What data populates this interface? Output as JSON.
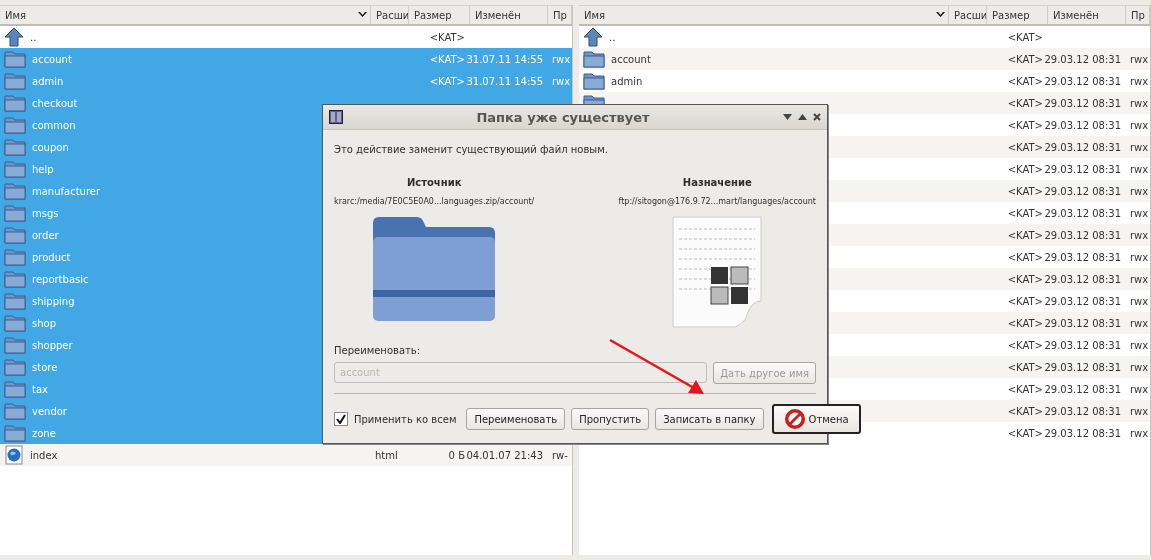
{
  "panels": [
    {
      "columns": [
        "Имя",
        "Расши",
        "Размер",
        "Изменён",
        "Пр"
      ],
      "rows": [
        {
          "kind": "parent",
          "name": "..",
          "size": "<KAT>",
          "selected": false
        },
        {
          "kind": "folder",
          "name": "account",
          "size": "<KAT>",
          "modified": "31.07.11 14:55",
          "perms": "rwx",
          "selected": true
        },
        {
          "kind": "folder",
          "name": "admin",
          "size": "<KAT>",
          "modified": "31.07.11 14:55",
          "perms": "rwx",
          "selected": true
        },
        {
          "kind": "folder",
          "name": "checkout",
          "selected": true
        },
        {
          "kind": "folder",
          "name": "common",
          "selected": true
        },
        {
          "kind": "folder",
          "name": "coupon",
          "selected": true
        },
        {
          "kind": "folder",
          "name": "help",
          "selected": true
        },
        {
          "kind": "folder",
          "name": "manufacturer",
          "selected": true
        },
        {
          "kind": "folder",
          "name": "msgs",
          "selected": true
        },
        {
          "kind": "folder",
          "name": "order",
          "selected": true
        },
        {
          "kind": "folder",
          "name": "product",
          "selected": true
        },
        {
          "kind": "folder",
          "name": "reportbasic",
          "selected": true
        },
        {
          "kind": "folder",
          "name": "shipping",
          "selected": true
        },
        {
          "kind": "folder",
          "name": "shop",
          "selected": true
        },
        {
          "kind": "folder",
          "name": "shopper",
          "selected": true
        },
        {
          "kind": "folder",
          "name": "store",
          "selected": true
        },
        {
          "kind": "folder",
          "name": "tax",
          "selected": true
        },
        {
          "kind": "folder",
          "name": "vendor",
          "selected": true
        },
        {
          "kind": "folder",
          "name": "zone",
          "selected": true
        },
        {
          "kind": "file",
          "name": "index",
          "ext": "html",
          "size": "0 Б",
          "modified": "04.01.07 21:43",
          "perms": "rw-",
          "selected": false
        }
      ]
    },
    {
      "columns": [
        "Имя",
        "Расши",
        "Размер",
        "Изменён",
        "Пр"
      ],
      "rows": [
        {
          "kind": "parent",
          "name": "..",
          "size": "<KAT>",
          "selected": false
        },
        {
          "kind": "folder",
          "name": "account",
          "size": "<KAT>",
          "modified": "29.03.12 08:31",
          "perms": "rwx",
          "selected": false
        },
        {
          "kind": "folder",
          "name": "admin",
          "size": "<KAT>",
          "modified": "29.03.12 08:31",
          "perms": "rwx",
          "selected": false
        },
        {
          "kind": "folder",
          "size": "<KAT>",
          "modified": "29.03.12 08:31",
          "perms": "rwx",
          "selected": false
        },
        {
          "size": "<KAT>",
          "modified": "29.03.12 08:31",
          "perms": "rwx",
          "selected": false
        },
        {
          "size": "<KAT>",
          "modified": "29.03.12 08:31",
          "perms": "rwx",
          "selected": false
        },
        {
          "size": "<KAT>",
          "modified": "29.03.12 08:31",
          "perms": "rwx",
          "selected": false
        },
        {
          "size": "<KAT>",
          "modified": "29.03.12 08:31",
          "perms": "rwx",
          "selected": false
        },
        {
          "size": "<KAT>",
          "modified": "29.03.12 08:31",
          "perms": "rwx",
          "selected": false
        },
        {
          "size": "<KAT>",
          "modified": "29.03.12 08:31",
          "perms": "rwx",
          "selected": false
        },
        {
          "size": "<KAT>",
          "modified": "29.03.12 08:31",
          "perms": "rwx",
          "selected": false
        },
        {
          "size": "<KAT>",
          "modified": "29.03.12 08:31",
          "perms": "rwx",
          "selected": false
        },
        {
          "size": "<KAT>",
          "modified": "29.03.12 08:31",
          "perms": "rwx",
          "selected": false
        },
        {
          "size": "<KAT>",
          "modified": "29.03.12 08:31",
          "perms": "rwx",
          "selected": false
        },
        {
          "size": "<KAT>",
          "modified": "29.03.12 08:31",
          "perms": "rwx",
          "selected": false
        },
        {
          "size": "<KAT>",
          "modified": "29.03.12 08:31",
          "perms": "rwx",
          "selected": false
        },
        {
          "size": "<KAT>",
          "modified": "29.03.12 08:31",
          "perms": "rwx",
          "selected": false
        },
        {
          "size": "<KAT>",
          "modified": "29.03.12 08:31",
          "perms": "rwx",
          "selected": false
        },
        {
          "size": "<KAT>",
          "modified": "29.03.12 08:31",
          "perms": "rwx",
          "selected": false
        }
      ]
    }
  ],
  "dialog": {
    "title": "Папка уже существует",
    "message": "Это действие заменит существующий файл новым.",
    "source": {
      "heading": "Источник",
      "path": "krarc:/media/7E0C5E0A0...languages.zip/account/"
    },
    "destination": {
      "heading": "Назначение",
      "path": "ftp://sitogon@176.9.72...mart/languages/account"
    },
    "rename_label": "Переименовать:",
    "rename_field": {
      "value": "account",
      "disabled": true
    },
    "suggest_button": {
      "label": "Дать другое имя",
      "disabled": true
    },
    "apply_all": {
      "label": "Применить ко всем",
      "checked": true
    },
    "buttons": [
      {
        "label": "Переименовать",
        "kind": "plain"
      },
      {
        "label": "Пропустить",
        "kind": "plain"
      },
      {
        "label": "Записать в папку",
        "kind": "plain"
      },
      {
        "label": "Отмена",
        "kind": "cancel"
      }
    ]
  }
}
